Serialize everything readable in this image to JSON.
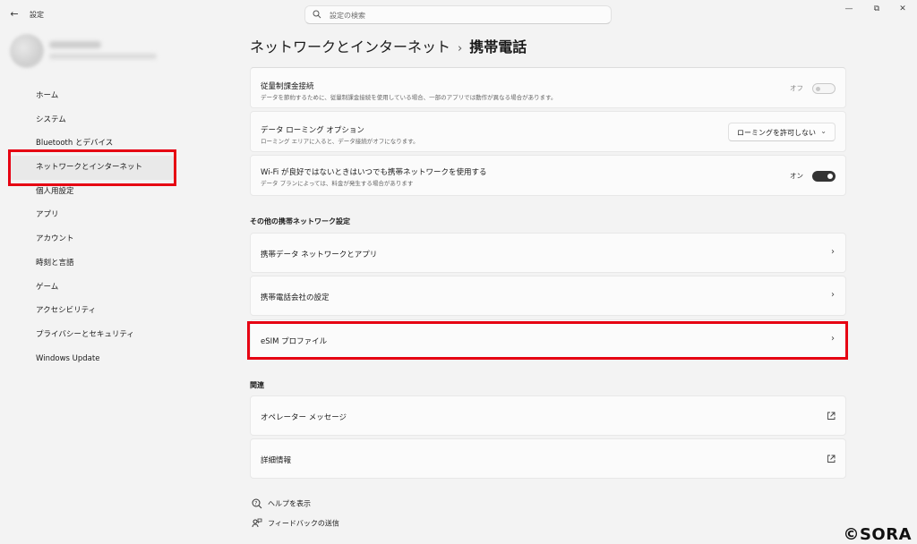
{
  "window": {
    "app_title": "設定",
    "back_icon": "←",
    "minimize": "—",
    "maximize": "⧉",
    "close": "✕"
  },
  "search": {
    "placeholder": "設定の検索"
  },
  "sidebar": {
    "items": [
      {
        "label": "ホーム"
      },
      {
        "label": "システム"
      },
      {
        "label": "Bluetooth とデバイス"
      },
      {
        "label": "ネットワークとインターネット",
        "selected": true
      },
      {
        "label": "個人用設定"
      },
      {
        "label": "アプリ"
      },
      {
        "label": "アカウント"
      },
      {
        "label": "時刻と言語"
      },
      {
        "label": "ゲーム"
      },
      {
        "label": "アクセシビリティ"
      },
      {
        "label": "プライバシーとセキュリティ"
      },
      {
        "label": "Windows Update"
      }
    ]
  },
  "breadcrumb": {
    "parent": "ネットワークとインターネット",
    "separator": "›",
    "current": "携帯電話"
  },
  "settings": {
    "metered": {
      "title": "従量制課金接続",
      "subtitle": "データを節約するために、従量制課金接続を使用している場合、一部のアプリでは動作が異なる場合があります。",
      "state_label": "オフ",
      "on": false
    },
    "roaming": {
      "title": "データ ローミング オプション",
      "subtitle": "ローミング エリアに入ると、データ接続がオフになります。",
      "selected": "ローミングを許可しない",
      "chevron": "⌄"
    },
    "wifi_fallback": {
      "title": "Wi-Fi が良好ではないときはいつでも携帯ネットワークを使用する",
      "subtitle": "データ プランによっては、料金が発生する場合があります",
      "state_label": "オン",
      "on": true
    }
  },
  "other_section": {
    "heading": "その他の携帯ネットワーク設定",
    "items": [
      {
        "label": "携帯データ ネットワークとアプリ"
      },
      {
        "label": "携帯電話会社の設定"
      },
      {
        "label": "eSIM プロファイル"
      }
    ],
    "chevron": "›"
  },
  "related_section": {
    "heading": "関連",
    "items": [
      {
        "label": "オペレーター メッセージ"
      },
      {
        "label": "詳細情報"
      }
    ]
  },
  "help": {
    "get_help": "ヘルプを表示",
    "feedback": "フィードバックの送信"
  },
  "watermark": "©SORA",
  "colors": {
    "highlight": "#e60012",
    "toggle_on": "#333333"
  }
}
